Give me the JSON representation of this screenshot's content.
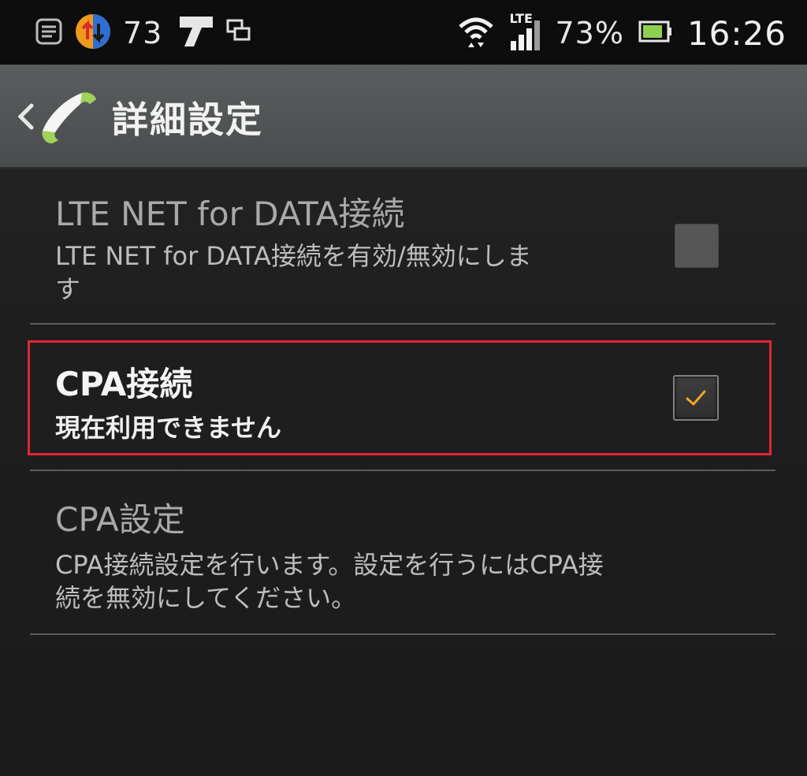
{
  "status_bar": {
    "notification_count": "73",
    "network_type": "LTE",
    "battery_percent": "73%",
    "clock": "16:26",
    "icons": [
      "notes-icon",
      "data-transfer-icon",
      "app-notification-icon",
      "screen-mirror-icon",
      "wifi-icon",
      "signal-icon",
      "battery-icon"
    ]
  },
  "action_bar": {
    "title": "詳細設定",
    "icons": [
      "back-chevron-icon",
      "phone-icon"
    ]
  },
  "settings": [
    {
      "title": "LTE NET for DATA接続",
      "summary_line1": "LTE NET for DATA接続を有効/無効にしま",
      "summary_line2": "す",
      "checked": false
    },
    {
      "title": "CPA接続",
      "summary_line1": "現在利用できません",
      "checked": true,
      "highlighted": true,
      "highlight_color": "#e2262e"
    },
    {
      "title": "CPA設定",
      "summary_line1": "CPA接続設定を行います。設定を行うにはCPA接",
      "summary_line2": "続を無効にしてください。"
    }
  ],
  "colors": {
    "status_bar_bg": "#0d0d0d",
    "action_bar_bg": "#4f5253",
    "list_bg": "#1f1f1f",
    "checkmark": "#f2a626",
    "phone_icon": "#9fd35a"
  }
}
